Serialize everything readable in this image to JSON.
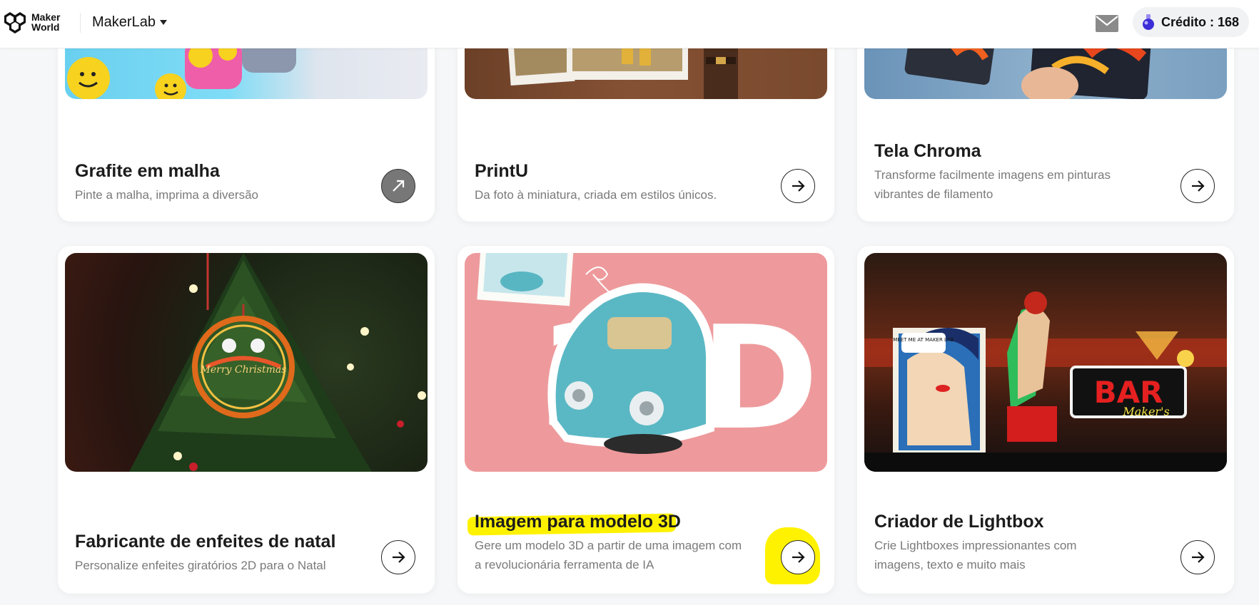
{
  "header": {
    "logo_line1": "Maker",
    "logo_line2": "World",
    "brand": "MakerLab",
    "credit_label": "Crédito : 168"
  },
  "cards": [
    {
      "title": "Grafite em malha",
      "desc": "Pinte a malha, imprima a diversão"
    },
    {
      "title": "PrintU",
      "desc": "Da foto à miniatura, criada em estilos únicos."
    },
    {
      "title": "Tela Chroma",
      "desc": "Transforme facilmente imagens em pinturas vibrantes de filamento"
    },
    {
      "title": "Fabricante de enfeites de natal",
      "desc": "Personalize enfeites giratórios 2D para o Natal"
    },
    {
      "title": "Imagem para modelo 3D",
      "desc": "Gere um modelo 3D a partir de uma imagem com a revolucionária ferramenta de IA"
    },
    {
      "title": "Criador de Lightbox",
      "desc": "Crie Lightboxes impressionantes com imagens, texto e muito mais"
    }
  ],
  "images": {
    "ornament_text": "Merry Christmas",
    "lightbox_sign": "BAR",
    "lightbox_script": "Maker's",
    "comic_bubble": "MEET ME AT MAKER LAB",
    "big_3d_left": "3",
    "big_3d_right": "D"
  },
  "colors": {
    "highlight": "#fff200",
    "pink_bg": "#ee9a9c",
    "car_teal": "#5ab8c4"
  },
  "icons": [
    "mail-icon",
    "potion-icon",
    "arrow-right-icon",
    "caret-down-icon"
  ]
}
